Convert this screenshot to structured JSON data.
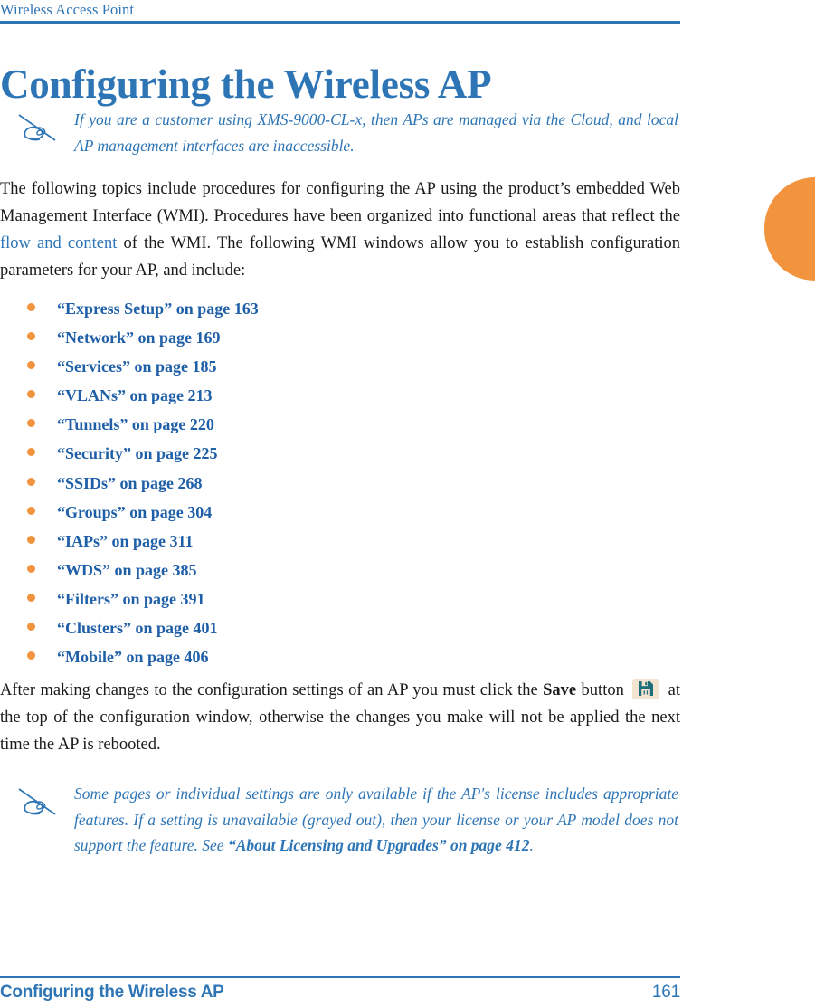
{
  "header": {
    "running_head": "Wireless Access Point",
    "chapter_title": "Configuring the Wireless AP"
  },
  "notes": [
    {
      "icon": "note-pen-hand-icon",
      "text_part1": "If you are a customer using XMS-9000-CL-x, then APs are managed via the Cloud, and local AP management interfaces are inaccessible.",
      "text_bold": "",
      "text_part2": ""
    },
    {
      "icon": "note-pen-hand-icon",
      "text_part1": "Some pages or individual settings are only available if the AP's license includes appropriate features. If a setting is unavailable (grayed out), then your license or your AP model does not support the feature. See ",
      "text_bold": "“About Licensing and Upgrades” on page 412",
      "text_part2": "."
    }
  ],
  "intro_paragraph": {
    "part1": "The following topics include procedures for configuring the AP using the product’s embedded Web Management Interface (WMI). Procedures have been organized into functional areas that reflect the ",
    "link": "flow and content",
    "part2": " of the WMI. The following WMI windows allow you to establish configuration parameters for your AP, and include:"
  },
  "topic_links": [
    {
      "label": "“Express Setup” on page 163"
    },
    {
      "label": "“Network” on page 169"
    },
    {
      "label": "“Services” on page 185"
    },
    {
      "label": "“VLANs” on page 213"
    },
    {
      "label": "“Tunnels” on page 220"
    },
    {
      "label": "“Security” on page 225"
    },
    {
      "label": "“SSIDs” on page 268"
    },
    {
      "label": "“Groups” on page 304"
    },
    {
      "label": "“IAPs” on page 311"
    },
    {
      "label": "“WDS” on page 385"
    },
    {
      "label": "“Filters” on page 391"
    },
    {
      "label": "“Clusters” on page 401"
    },
    {
      "label": "“Mobile” on page 406"
    }
  ],
  "save_paragraph": {
    "part1": "After making changes to the configuration settings of an AP you must click the ",
    "bold": "Save",
    "part2": " button ",
    "icon": "save-floppy-disk-icon",
    "part3": " at the top of the configuration window, otherwise the changes you make will not be applied the next time the AP is rebooted."
  },
  "footer": {
    "section": "Configuring the Wireless AP",
    "page_number": "161"
  },
  "colors": {
    "heading_blue": "#2E75B6",
    "link_blue": "#1F5FA8",
    "accent_orange": "#F2943D",
    "save_icon_teal": "#1F6E7E",
    "save_icon_bg": "#F2E4CF"
  }
}
